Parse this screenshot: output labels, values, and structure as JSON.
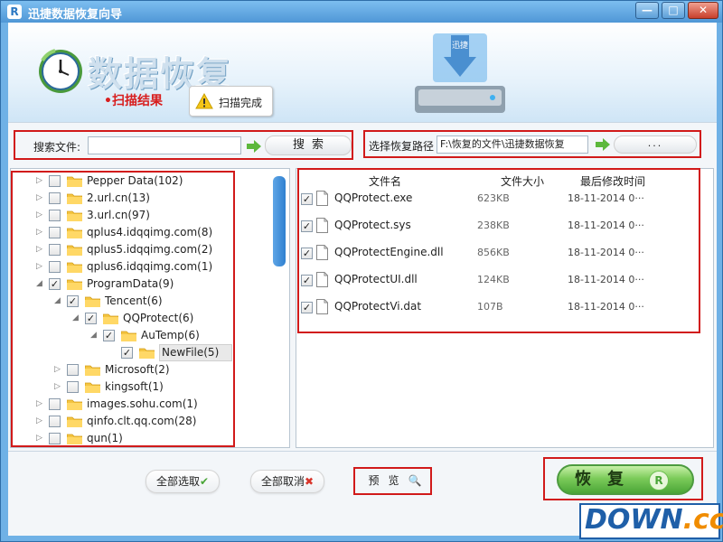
{
  "window": {
    "title": "迅捷数据恢复向导",
    "app_icon_letter": "R",
    "min_glyph": "—",
    "max_glyph": "□",
    "close_glyph": "✕"
  },
  "header": {
    "title": "数据恢复",
    "scan_label": "•扫描结果",
    "scan_status": "扫描完成",
    "drive_label": "迅捷"
  },
  "search": {
    "label": "搜索文件:",
    "value": "",
    "button_label": "搜索"
  },
  "restore_path": {
    "label": "选择恢复路径",
    "value": "F:\\恢复的文件\\迅捷数据恢复",
    "browse_label": "..."
  },
  "tree": {
    "items": [
      {
        "label": "Pepper Data(102)",
        "level": 0,
        "toggle": "▷",
        "checked": false
      },
      {
        "label": "2.url.cn(13)",
        "level": 0,
        "toggle": "▷",
        "checked": false
      },
      {
        "label": "3.url.cn(97)",
        "level": 0,
        "toggle": "▷",
        "checked": false
      },
      {
        "label": "qplus4.idqqimg.com(8)",
        "level": 0,
        "toggle": "▷",
        "checked": false
      },
      {
        "label": "qplus5.idqqimg.com(2)",
        "level": 0,
        "toggle": "▷",
        "checked": false
      },
      {
        "label": "qplus6.idqqimg.com(1)",
        "level": 0,
        "toggle": "▷",
        "checked": false
      },
      {
        "label": "ProgramData(9)",
        "level": 0,
        "toggle": "◢",
        "checked": true
      },
      {
        "label": "Tencent(6)",
        "level": 1,
        "toggle": "◢",
        "checked": true
      },
      {
        "label": "QQProtect(6)",
        "level": 2,
        "toggle": "◢",
        "checked": true
      },
      {
        "label": "AuTemp(6)",
        "level": 3,
        "toggle": "◢",
        "checked": true
      },
      {
        "label": "NewFile(5)",
        "level": 4,
        "toggle": "",
        "checked": true,
        "selected": true
      },
      {
        "label": "Microsoft(2)",
        "level": 1,
        "toggle": "▷",
        "checked": false
      },
      {
        "label": "kingsoft(1)",
        "level": 1,
        "toggle": "▷",
        "checked": false
      },
      {
        "label": "images.sohu.com(1)",
        "level": 0,
        "toggle": "▷",
        "checked": false
      },
      {
        "label": "qinfo.clt.qq.com(28)",
        "level": 0,
        "toggle": "▷",
        "checked": false
      },
      {
        "label": "qun(1)",
        "level": 0,
        "toggle": "▷",
        "checked": false
      }
    ]
  },
  "files": {
    "columns": [
      "文件名",
      "文件大小",
      "最后修改时间"
    ],
    "rows": [
      {
        "name": "QQProtect.exe",
        "size": "623KB",
        "date": "18-11-2014 0···",
        "checked": true
      },
      {
        "name": "QQProtect.sys",
        "size": "238KB",
        "date": "18-11-2014 0···",
        "checked": true
      },
      {
        "name": "QQProtectEngine.dll",
        "size": "856KB",
        "date": "18-11-2014 0···",
        "checked": true
      },
      {
        "name": "QQProtectUI.dll",
        "size": "124KB",
        "date": "18-11-2014 0···",
        "checked": true
      },
      {
        "name": "QQProtectVi.dat",
        "size": "107B",
        "date": "18-11-2014 0···",
        "checked": true
      }
    ]
  },
  "footer": {
    "select_all": "全部选取",
    "deselect_all": "全部取消",
    "preview": "预览",
    "recover": "恢复",
    "recover_badge": "R"
  },
  "watermark": {
    "main": "DOWN",
    "suffix": ".cc"
  },
  "colors": {
    "accent": "#2c78c2",
    "highlight_box": "#d11a1a",
    "recover_green": "#4aa537"
  }
}
